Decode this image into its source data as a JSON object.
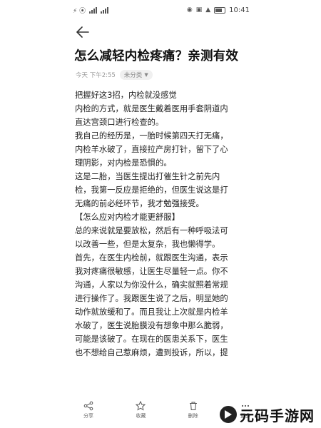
{
  "status_bar": {
    "left_glyphs": "⚡ ⦿",
    "clock": "10:41"
  },
  "article": {
    "title": "怎么减轻内检疼痛？亲测有效",
    "date": "今天 下午2:55",
    "category": "未分类",
    "lines": [
      "把握好这3招，内检就没感觉",
      "内检的方式，就是医生戴着医用手套阴道内",
      "直达宫颈口进行检查的。",
      "我自己的经历是，一胎时候第四天打无痛，",
      "内检羊水破了，直接拉产房打针，留下了心",
      "理阴影，对内检是恐惧的。",
      "这是二胎，当医生提出打催生针之前先内",
      "检，我第一反应是拒绝的，但医生说这是打",
      "无痛的前必经环节，我才勉强接受。",
      "【怎么应对内检才能更舒服】",
      "总的来说就是要放松，然后有一种呼吸法可",
      "以改善一些，但是太复杂，我也懒得学。",
      "首先，在医生内检前，就跟医生沟通，表示",
      "我对疼痛很敏感，让医生尽量轻一点。你不",
      "沟通，人家以为你没什么，确实就照着常规",
      "进行操作了。我跟医生说了之后，明显她的",
      "动作就放缓和了。而且我让上次就是内检羊",
      "水破了，医生说胎膜没有想象中那么脆弱，",
      "可能是该破了。在现在的医患关系下，医生",
      "也不想给自己惹麻烦，遭到投诉，所以，提"
    ]
  },
  "bottom_bar": {
    "share_label": "分享",
    "favorite_label": "收藏",
    "delete_label": "删除",
    "more_label": "更多"
  },
  "watermark": {
    "text": "元码手游网"
  }
}
